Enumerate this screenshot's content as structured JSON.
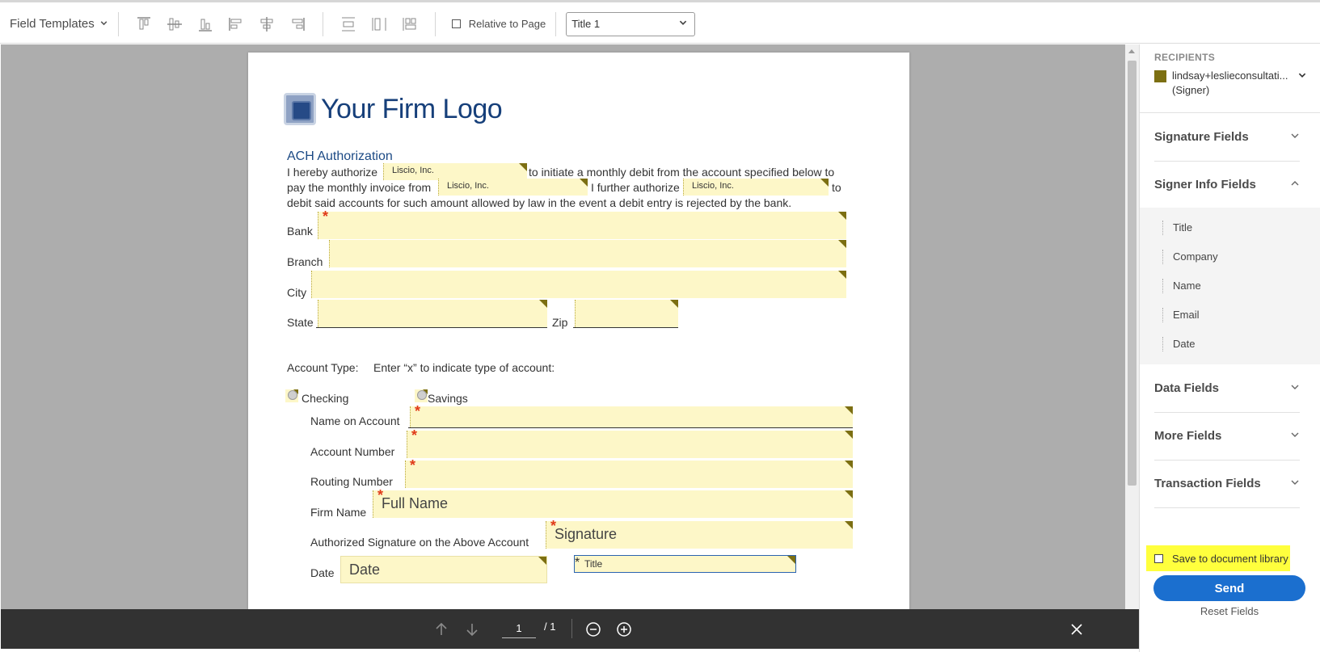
{
  "toolbar": {
    "field_templates": "Field Templates",
    "relative_to_page": "Relative to Page",
    "field_select_value": "Title 1",
    "align_icons": [
      "align-top-icon",
      "align-middle-icon",
      "align-bottom-icon",
      "align-left-icon",
      "align-center-icon",
      "align-right-icon",
      "distribute-vertical-icon",
      "distribute-horizontal-icon",
      "match-size-icon"
    ]
  },
  "document": {
    "logo_text": "Your Firm Logo",
    "heading": "ACH Authorization",
    "p1_a": "I hereby authorize",
    "p1_b": "to initiate a monthly debit from the account specified below to",
    "p2_a": "pay the monthly invoice from",
    "p2_b": "I further authorize",
    "p2_c": "to",
    "p3": "debit said accounts for such amount allowed by law in the event a debit entry is rejected by the bank.",
    "company_value": "Liscio, Inc.",
    "labels": {
      "bank": "Bank",
      "branch": "Branch",
      "city": "City",
      "state": "State",
      "zip": "Zip",
      "account_type": "Account Type:",
      "account_type_hint": "Enter “x” to indicate type of account:",
      "checking": "Checking",
      "savings": "Savings",
      "name_on_account": "Name on Account",
      "account_number": "Account Number",
      "routing_number": "Routing Number",
      "firm_name": "Firm Name",
      "authorized_signature": "Authorized Signature on the Above Account",
      "date": "Date"
    },
    "placeholders": {
      "full_name": "Full Name",
      "signature": "Signature",
      "date": "Date",
      "title": "Title"
    },
    "required_mark": "*"
  },
  "navbar": {
    "page_current": "1",
    "page_total": "/ 1"
  },
  "panel": {
    "recipients_title": "RECIPIENTS",
    "recipient_name": "lindsay+leslieconsultati...",
    "recipient_role": "(Signer)",
    "recipient_color": "#7c6f12",
    "sections": [
      "Signature Fields",
      "Signer Info Fields",
      "Data Fields",
      "More Fields",
      "Transaction Fields"
    ],
    "signer_info_items": [
      "Title",
      "Company",
      "Name",
      "Email",
      "Date"
    ],
    "save_to_library": "Save to document library",
    "send": "Send",
    "reset": "Reset Fields",
    "send_color": "#1b6fcf",
    "highlight_color": "#ffff3d"
  }
}
